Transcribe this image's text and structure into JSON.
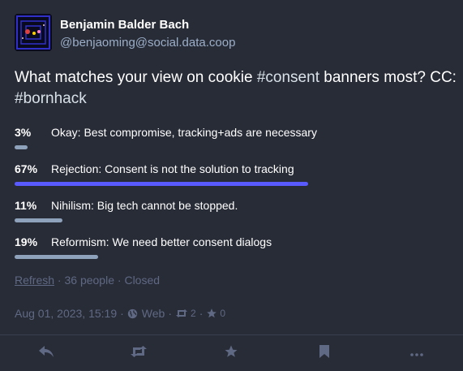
{
  "account": {
    "display_name": "Benjamin Balder Bach",
    "acct": "@benjaoming@social.data.coop"
  },
  "status": {
    "text_before": "What matches your view on cookie ",
    "hashtag_1": "#consent",
    "text_middle": " banners most? CC: ",
    "hashtag_2": "#bornhack"
  },
  "poll": {
    "options": [
      {
        "percent_label": "3%",
        "percent": 3,
        "text": "Okay: Best compromise, tracking+ads are necessary",
        "leading": false
      },
      {
        "percent_label": "67%",
        "percent": 67,
        "text": "Rejection: Consent is not the solution to tracking",
        "leading": true
      },
      {
        "percent_label": "11%",
        "percent": 11,
        "text": "Nihilism: Big tech cannot be stopped.",
        "leading": false
      },
      {
        "percent_label": "19%",
        "percent": 19,
        "text": "Reformism: We need better consent dialogs",
        "leading": false
      }
    ],
    "refresh_label": "Refresh",
    "sep": "·",
    "people": "36 people",
    "state": "Closed"
  },
  "meta": {
    "date": "Aug 01, 2023, 15:19",
    "sep": "·",
    "visibility_icon": "globe-icon",
    "application": "Web",
    "reblog_count": "2",
    "favourite_count": "0"
  },
  "colors": {
    "background": "#282c37",
    "leading_bar": "#595aff",
    "bar": "#8fa2bc",
    "muted": "#606984",
    "acct": "#9baec8"
  },
  "actions": [
    "reply-icon",
    "boost-icon",
    "favourite-icon",
    "bookmark-icon",
    "more-icon"
  ]
}
